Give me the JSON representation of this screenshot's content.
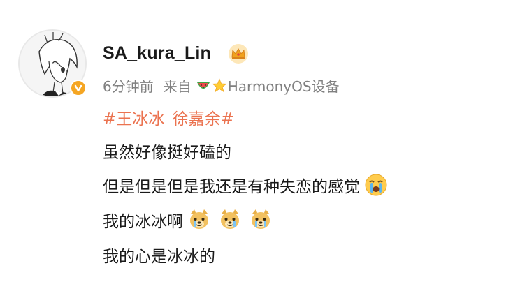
{
  "post": {
    "username": "SA_kura_Lin",
    "time": "6分钟前",
    "source_prefix": "来自",
    "source_device": "HarmonyOS设备",
    "hashtags": [
      "#王冰冰",
      "徐嘉余#"
    ],
    "lines": [
      "虽然好像挺好磕的",
      "但是但是但是我还是有种失恋的感觉",
      "我的冰冰啊",
      "我的心是冰冰的"
    ]
  },
  "icons": {
    "avatar": "anime-girl-avatar",
    "verified": "verified-badge-icon",
    "crown": "crown-icon",
    "watermelon": "watermelon-icon",
    "star": "star-icon",
    "crying": "crying-face-icon",
    "doge": "doge-emoji-icon"
  },
  "colors": {
    "hashtag": "#eb7350",
    "meta": "#808080",
    "verified": "#f5a623",
    "crown": "#f0a21d"
  }
}
